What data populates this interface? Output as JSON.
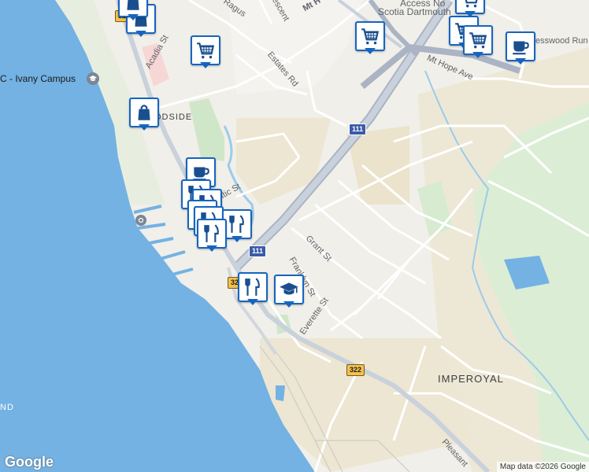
{
  "roads": {
    "mt_hope_ave": "Mt Hope Ave",
    "mt_h": "Mt H",
    "estates_rd": "Estates Rd",
    "acadia_st": "Acadia St",
    "ragus": "Ragus",
    "crescent": "escent",
    "pinewood_run": "esswood Run",
    "atlantic_st": "ntic St",
    "grant_st": "Grant St",
    "franklyn_st": "Franklyn St",
    "everette_st": "Everette St",
    "pleasant": "Pleasant"
  },
  "areas": {
    "imperoyal": "IMPEROYAL",
    "woodside": "ODSIDE",
    "nd": "ND"
  },
  "pois": {
    "ivany_campus": "C - Ivany Campus",
    "access_ns": "Access No",
    "scotia_dartmouth": "Scotia Dartmouth"
  },
  "shields": {
    "hwy111_a": "111",
    "hwy111_b": "111",
    "hwy322_a": "322",
    "hwy322_b": "322",
    "hwy322_c": "322"
  },
  "footer": {
    "logo": "Google",
    "attribution": "Map data ©2026 Google"
  },
  "colors": {
    "water": "#73b2e3",
    "land": "#f1efe9",
    "park": "#d5ead0",
    "marker_border": "#1565c0",
    "icon": "#1a4f8f"
  }
}
